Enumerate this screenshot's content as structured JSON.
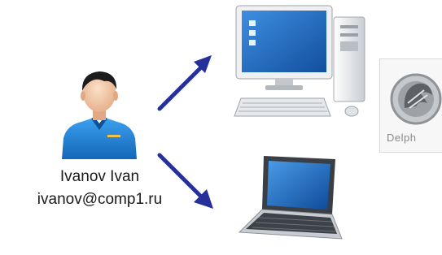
{
  "user": {
    "name": "Ivanov Ivan",
    "email": "ivanov@comp1.ru"
  },
  "delphi": {
    "label": "Delph"
  },
  "colors": {
    "arrow": "#25309a",
    "shirt": "#1f7fcf",
    "skin": "#f3c9a6",
    "hair": "#1c1c1c",
    "screen": "#1d6fd1"
  },
  "icons": {
    "user": "person-icon",
    "desktop": "desktop-computer-icon",
    "laptop": "laptop-icon",
    "delphi": "delphi-logo-icon"
  }
}
